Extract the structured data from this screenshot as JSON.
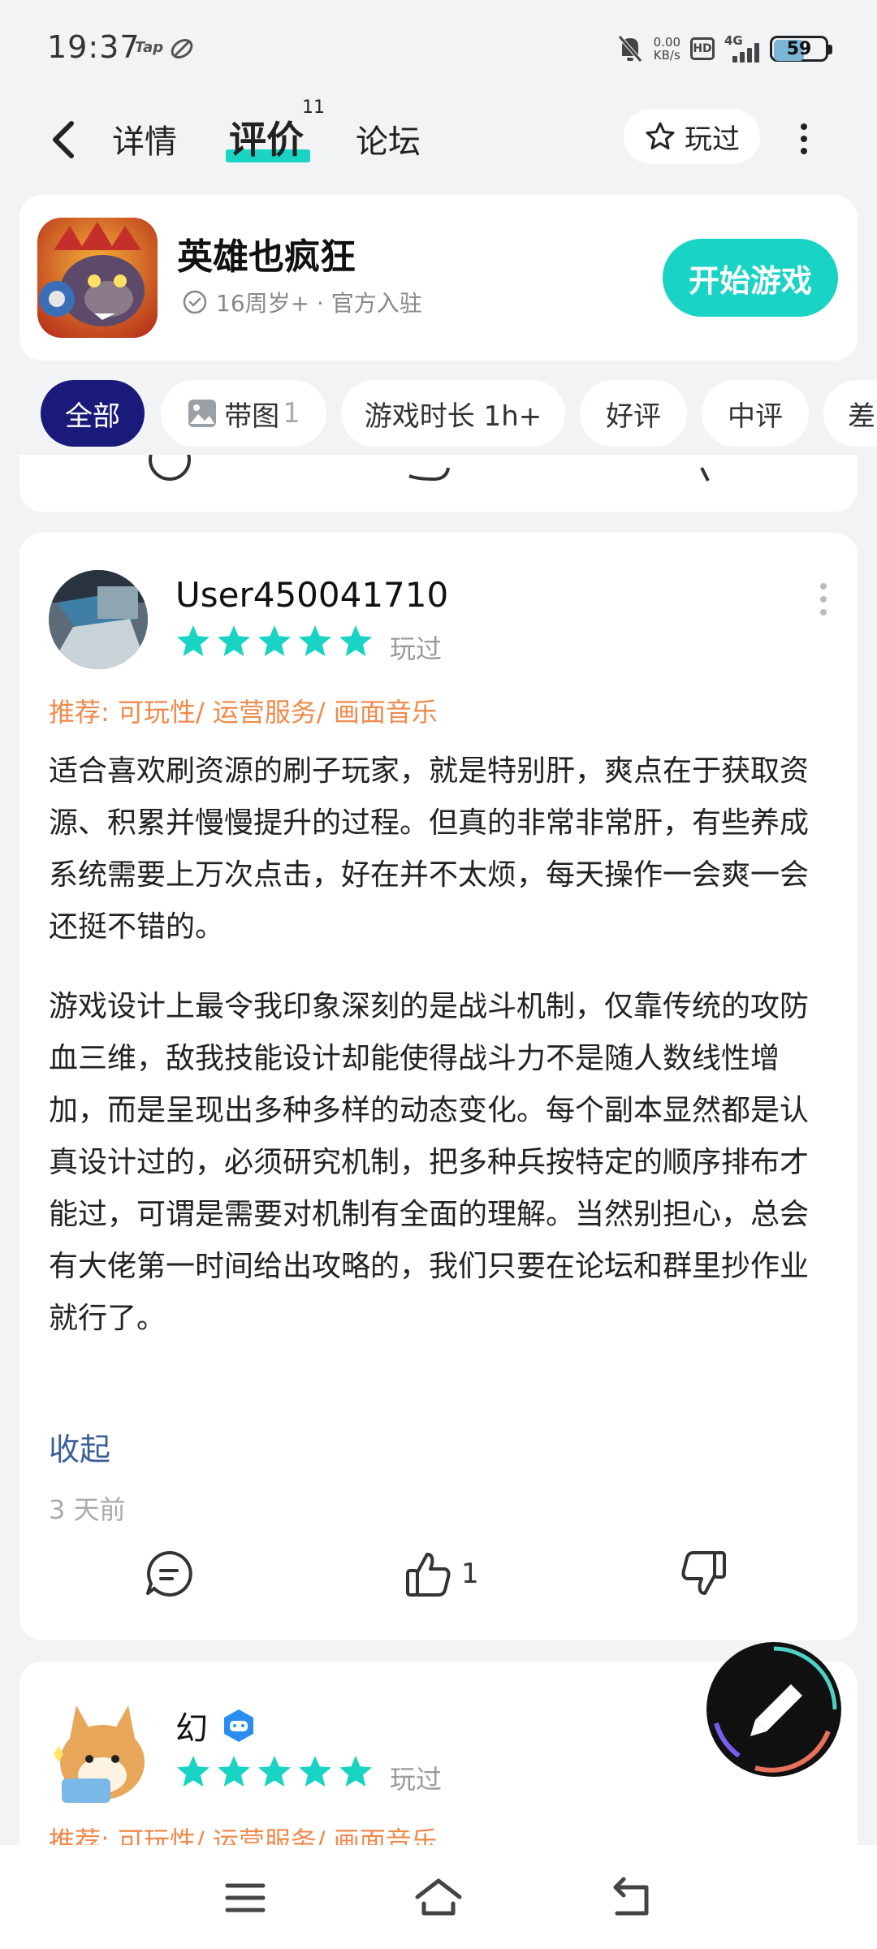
{
  "status_bar": {
    "time": "19:37",
    "tap_label": "Tap",
    "net_speed": "0.00",
    "net_unit": "KB/s",
    "hd": "HD",
    "network": "4G",
    "battery": "59",
    "battery_level": 0.59
  },
  "nav": {
    "tabs": [
      {
        "label": "详情"
      },
      {
        "label": "评价",
        "badge": "11",
        "active": true
      },
      {
        "label": "论坛"
      }
    ],
    "played_button": "玩过"
  },
  "game": {
    "title": "英雄也疯狂",
    "meta": "16周岁+ · 官方入驻",
    "start_button": "开始游戏"
  },
  "filters": [
    {
      "label": "全部",
      "active": true
    },
    {
      "label": "带图",
      "count": "1"
    },
    {
      "label": "游戏时长 1h+"
    },
    {
      "label": "好评"
    },
    {
      "label": "中评"
    },
    {
      "label": "差"
    }
  ],
  "review": {
    "username": "User450041710",
    "rating": 5,
    "status": "玩过",
    "recommend": "推荐: 可玩性/ 运营服务/ 画面音乐",
    "paragraph1": "适合喜欢刷资源的刷子玩家，就是特别肝，爽点在于获取资源、积累并慢慢提升的过程。但真的非常非常肝，有些养成系统需要上万次点击，好在并不太烦，每天操作一会爽一会还挺不错的。",
    "paragraph2": "游戏设计上最令我印象深刻的是战斗机制，仅靠传统的攻防血三维，敌我技能设计却能使得战斗力不是随人数线性增加，而是呈现出多种多样的动态变化。每个副本显然都是认真设计过的，必须研究机制，把多种兵按特定的顺序排布才能过，可谓是需要对机制有全面的理解。当然别担心，总会有大佬第一时间给出攻略的，我们只要在论坛和群里抄作业就行了。",
    "collapse": "收起",
    "time_ago": "3 天前",
    "like_count": "1"
  },
  "review2": {
    "username": "幻",
    "rating": 5,
    "status": "玩过",
    "recommend": "推荐: 可玩性/ 运营服务/ 画面音乐"
  },
  "colors": {
    "accent": "#19d3c5",
    "active_chip": "#1a1a7a",
    "recommend": "#f08a4b",
    "link": "#3b5f9a"
  }
}
